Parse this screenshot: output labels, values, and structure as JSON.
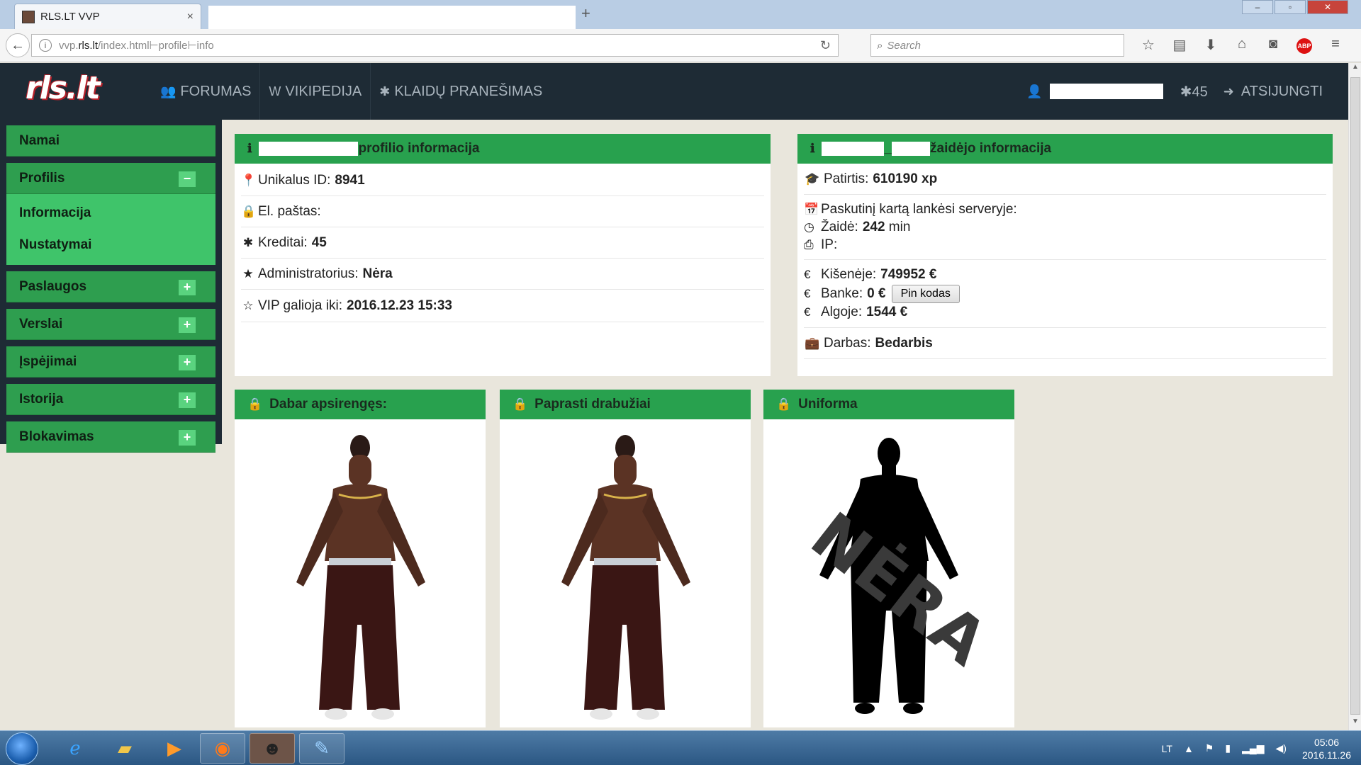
{
  "browser": {
    "tab_title": "RLS.LT VVP",
    "tab_close": "×",
    "new_tab": "+",
    "url_prefix": "vvp.",
    "url_domain": "rls.lt",
    "url_path": "/index.html⊢profile⊢info",
    "search_placeholder": "Search"
  },
  "site": {
    "logo_text": "rls.lt",
    "menu": [
      {
        "icon": "users-icon",
        "glyph": "👥",
        "label": "FORUMAS"
      },
      {
        "icon": "wikipedia-icon",
        "glyph": "W",
        "label": "VIKIPEDIJA"
      },
      {
        "icon": "bug-icon",
        "glyph": "✱",
        "label": "KLAIDŲ PRANEŠIMAS"
      }
    ],
    "credits": "✱45",
    "logout": "ATSIJUNGTI"
  },
  "sidebar": {
    "items": [
      {
        "label": "Namai",
        "toggle": ""
      },
      {
        "label": "Profilis",
        "toggle": "−"
      },
      {
        "label": "Paslaugos",
        "toggle": "+"
      },
      {
        "label": "Verslai",
        "toggle": "+"
      },
      {
        "label": "Įspėjimai",
        "toggle": "+"
      },
      {
        "label": "Istorija",
        "toggle": "+"
      },
      {
        "label": "Blokavimas",
        "toggle": "+"
      }
    ],
    "profile_sub": [
      "Informacija",
      "Nustatymai"
    ]
  },
  "profile_panel": {
    "title": "profilio informacija",
    "rows": [
      {
        "label": "Unikalus ID:",
        "value": "8941"
      },
      {
        "label": "El. paštas:",
        "value": ""
      },
      {
        "label": "Kreditai:",
        "value": "45"
      },
      {
        "label": "Administratorius:",
        "value": "Nėra"
      },
      {
        "label": "VIP galioja iki:",
        "value": "2016.12.23 15:33"
      }
    ]
  },
  "player_panel": {
    "title_mid": "_",
    "title": "žaidėjo informacija",
    "experience_label": "Patirtis:",
    "experience_value": "610190 xp",
    "last_visit_label": "Paskutinį kartą lankėsi serveryje:",
    "played_label": "Žaidė:",
    "played_value": "242",
    "played_unit": "min",
    "ip_label": "IP:",
    "pocket_label": "Kišenėje:",
    "pocket_value": "749952 €",
    "bank_label": "Banke:",
    "bank_value": "0 €",
    "pin_button": "Pin kodas",
    "salary_label": "Algoje:",
    "salary_value": "1544 €",
    "job_label": "Darbas:",
    "job_value": "Bedarbis"
  },
  "clothes": [
    {
      "title": "Dabar apsirengęs:"
    },
    {
      "title": "Paprasti drabužiai"
    },
    {
      "title": "Uniforma",
      "overlay": "NĖRA"
    }
  ],
  "taskbar": {
    "lang": "LT",
    "time": "05:06",
    "date": "2016.11.26"
  },
  "colors": {
    "accent_green": "#28a14e",
    "header_dark": "#1e2b35",
    "page_bg": "#e9e6dc"
  }
}
